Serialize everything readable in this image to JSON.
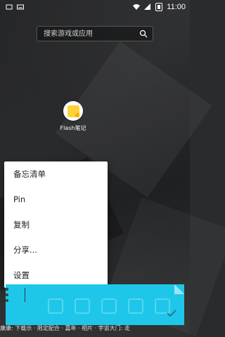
{
  "status_bar": {
    "time": "11:00",
    "battery_text": "!"
  },
  "search": {
    "placeholder": "搜索游戏或应用"
  },
  "app": {
    "label": "Flash笔记"
  },
  "menu": {
    "items": [
      {
        "label": "备忘清单"
      },
      {
        "label": "Pin"
      },
      {
        "label": "复制"
      },
      {
        "label": "分享..."
      },
      {
        "label": "设置"
      }
    ]
  },
  "bottom_text": "康康: 下载示 · 限定配合 · 嘉年 · 相片 · 宇宙大门: 走",
  "colors": {
    "widget_bg": "#1ec7ea",
    "menu_bg": "#ffffff",
    "note_yellow": "#ffd23a"
  }
}
